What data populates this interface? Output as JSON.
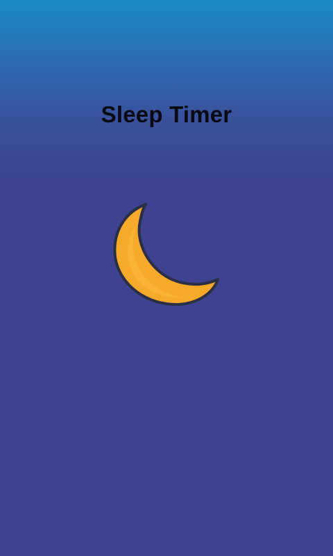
{
  "app": {
    "title": "Sleep Timer"
  },
  "moon": {
    "icon": "crescent-moon-icon",
    "fill_color": "#f7a92a",
    "highlight_color": "#fbb73a",
    "outline_color": "#2b2f46"
  },
  "colors": {
    "background_top": "#1a8cc2",
    "background_main": "#3d4391",
    "title_text": "#0a0a14"
  }
}
